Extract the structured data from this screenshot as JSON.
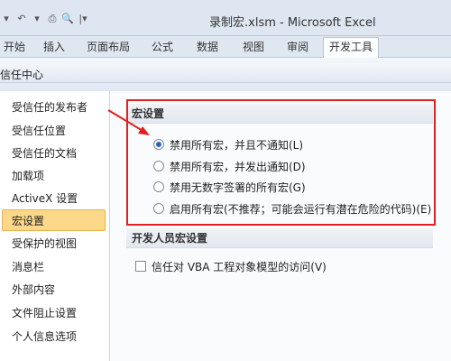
{
  "window": {
    "title": "录制宏.xlsm  -  Microsoft Excel"
  },
  "qat": {
    "icons": [
      "excel-icon",
      "undo-icon",
      "dropdown-icon",
      "print-icon",
      "preview-icon",
      "customize-icon"
    ]
  },
  "ribbon_tabs": [
    "开始",
    "插入",
    "页面布局",
    "公式",
    "数据",
    "视图",
    "审阅",
    "开发工具"
  ],
  "active_tab": "开发工具",
  "trust_center": {
    "title": "信任中心"
  },
  "nav": {
    "items": [
      "受信任的发布者",
      "受信任位置",
      "受信任的文档",
      "加载项",
      "ActiveX 设置",
      "宏设置",
      "受保护的视图",
      "消息栏",
      "外部内容",
      "文件阻止设置",
      "个人信息选项"
    ],
    "selected": "宏设置"
  },
  "macro_settings": {
    "heading": "宏设置",
    "options": [
      "禁用所有宏，并且不通知(L)",
      "禁用所有宏，并发出通知(D)",
      "禁用无数字签署的所有宏(G)",
      "启用所有宏(不推荐；可能会运行有潜在危险的代码)(E)"
    ],
    "selected_index": 0
  },
  "developer_settings": {
    "heading": "开发人员宏设置",
    "checkbox_label": "信任对 VBA 工程对象模型的访问(V)",
    "checked": false
  },
  "colors": {
    "annotation": "#e02020",
    "selection": "#fcd98a",
    "radio_dot": "#2a63b8"
  }
}
